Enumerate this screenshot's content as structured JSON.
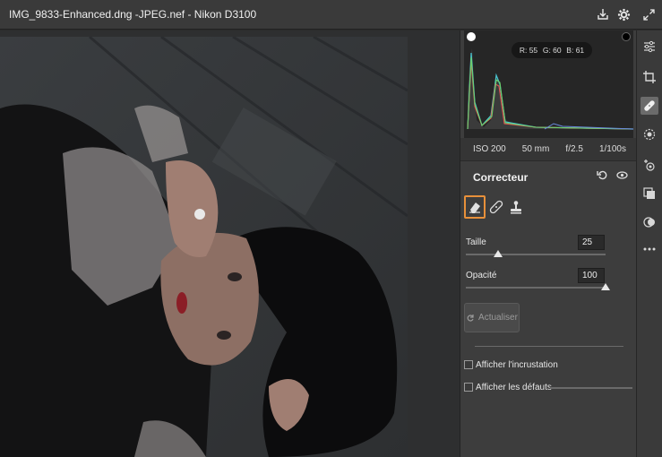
{
  "titlebar": {
    "title": "IMG_9833-Enhanced.dng -JPEG.nef  -  Nikon D3100",
    "icons": [
      "save-icon",
      "gear-icon",
      "expand-icon"
    ]
  },
  "histogram": {
    "r_label": "R: 55",
    "g_label": "G: 60",
    "b_label": "B: 61"
  },
  "exif": {
    "iso": "ISO 200",
    "focal": "50 mm",
    "aperture": "f/2.5",
    "shutter": "1/100s"
  },
  "section": {
    "title": "Correcteur",
    "tools": [
      "eraser-icon",
      "bandage-icon",
      "stamp-icon"
    ],
    "size_label": "Taille",
    "size_value": "25",
    "size_fraction": 0.23,
    "opacity_label": "Opacité",
    "opacity_value": "100",
    "opacity_fraction": 1.0,
    "refresh_label": "Actualiser",
    "overlay_label": "Afficher l'incrustation",
    "defects_label": "Afficher les défauts"
  },
  "rail_icons": [
    "sliders-icon",
    "crop-icon",
    "bandage-icon",
    "mask-icon",
    "redeye-icon",
    "layers-icon",
    "presets-icon",
    "more-icon"
  ],
  "colors": {
    "accent": "#e8903a"
  }
}
